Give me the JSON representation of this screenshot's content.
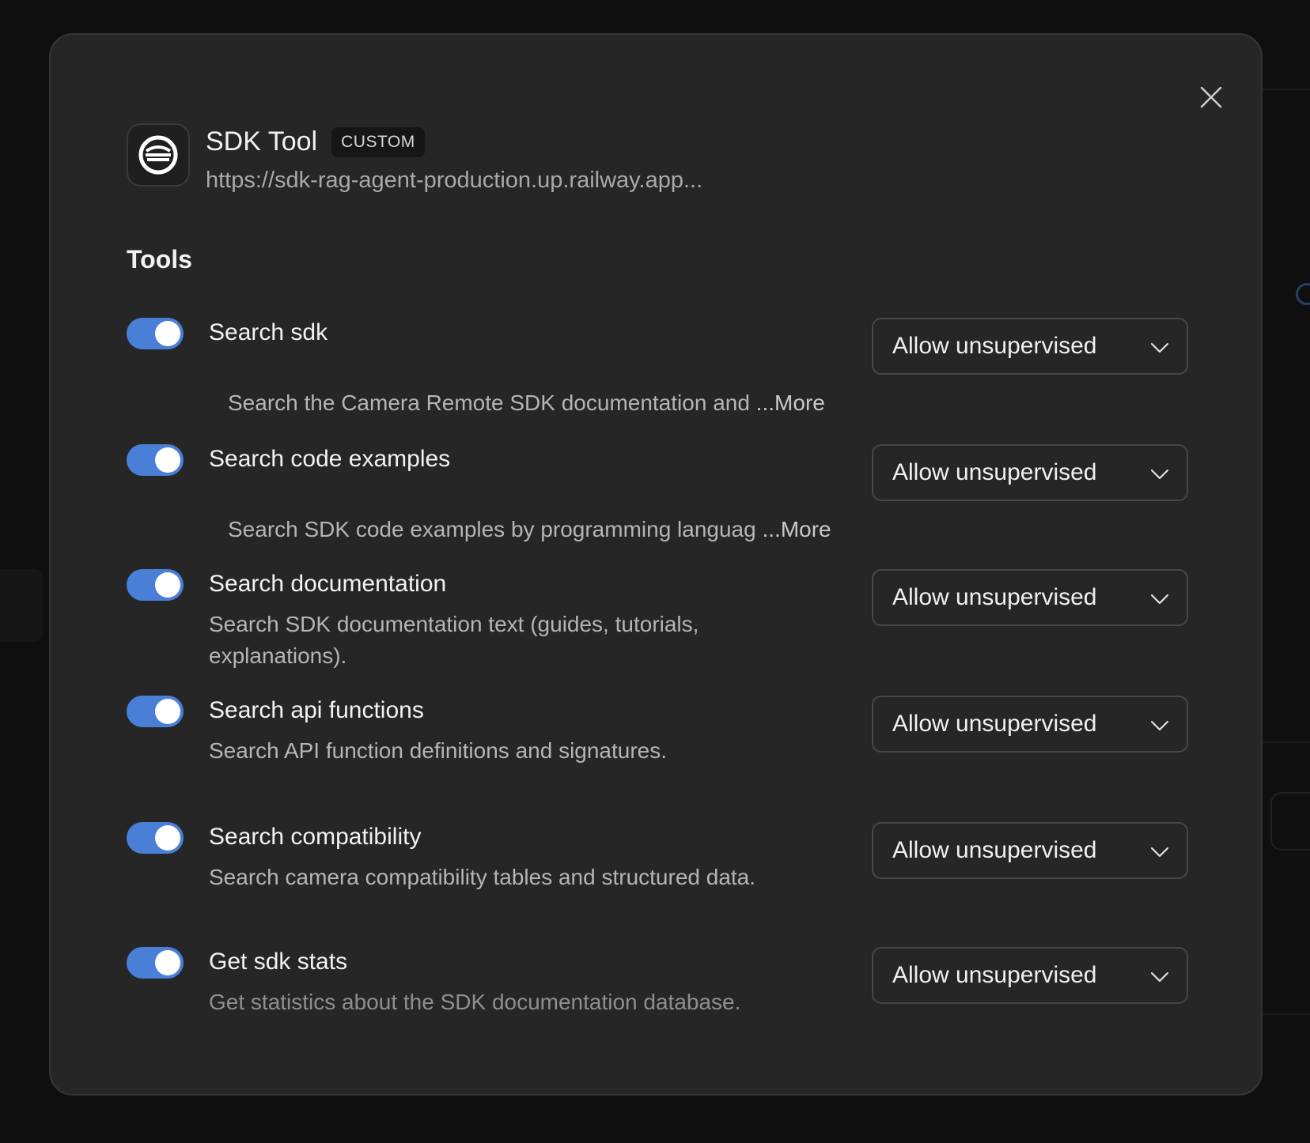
{
  "header": {
    "title": "SDK Tool",
    "badge": "CUSTOM",
    "url": "https://sdk-rag-agent-production.up.railway.app..."
  },
  "section_title": "Tools",
  "more_label": "...More",
  "tools": [
    {
      "name": "Search sdk",
      "description": "Search the Camera Remote SDK documentation and",
      "enabled": true,
      "permission": "Allow unsupervised"
    },
    {
      "name": "Search code examples",
      "description": "Search SDK code examples by programming languag",
      "enabled": true,
      "permission": "Allow unsupervised"
    },
    {
      "name": "Search documentation",
      "description": "Search SDK documentation text (guides, tutorials, explanations).",
      "enabled": true,
      "permission": "Allow unsupervised"
    },
    {
      "name": "Search api functions",
      "description": "Search API function definitions and signatures.",
      "enabled": true,
      "permission": "Allow unsupervised"
    },
    {
      "name": "Search compatibility",
      "description": "Search camera compatibility tables and structured data.",
      "enabled": true,
      "permission": "Allow unsupervised"
    },
    {
      "name": "Get sdk stats",
      "description": "Get statistics about the SDK documentation database.",
      "enabled": true,
      "permission": "Allow unsupervised"
    }
  ],
  "colors": {
    "toggle_on": "#4a7fd8",
    "modal_bg": "#262626",
    "page_bg": "#0f0f0f"
  }
}
